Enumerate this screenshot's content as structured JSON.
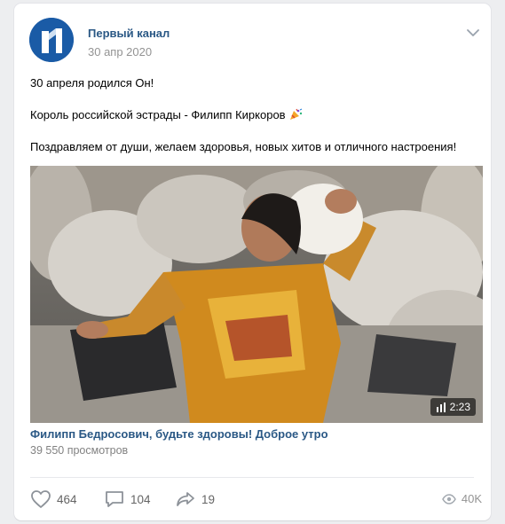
{
  "post": {
    "author": "Первый канал",
    "date": "30 апр 2020",
    "text_lines": [
      "30 апреля родился Он!",
      "Король российской эстрады - Филипп Киркоров",
      "Поздравляем от души, желаем здоровья, новых хитов и отличного настроения!"
    ],
    "video": {
      "duration": "2:23",
      "title": "Филипп Бедросович, будьте здоровы! Доброе утро",
      "views": "39 550 просмотров"
    },
    "actions": {
      "likes": "464",
      "comments": "104",
      "shares": "19",
      "views": "40K"
    },
    "icons": {
      "avatar": "channel-one-logo",
      "menu": "chevron-down-icon",
      "emoji": "party-popper-icon",
      "like": "heart-icon",
      "comment": "comment-icon",
      "share": "share-arrow-icon",
      "views": "eye-icon",
      "duration": "bars-icon"
    },
    "colors": {
      "page_bg": "#edeef0",
      "link": "#2a5885",
      "muted": "#939393",
      "logo_blue": "#1a5ba6"
    }
  }
}
